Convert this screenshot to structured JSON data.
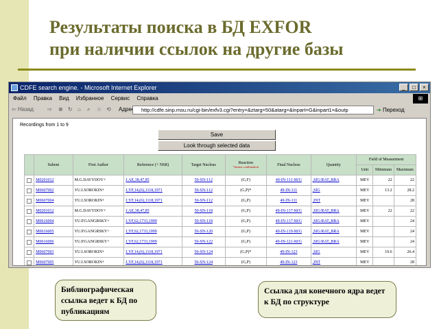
{
  "slide": {
    "title_line1": "Результаты поиска в БД EXFOR",
    "title_line2": "при наличии ссылок на другие базы"
  },
  "window": {
    "title": "CDFE search engine. - Microsoft Internet Explorer",
    "menu": [
      "Файл",
      "Правка",
      "Вид",
      "Избранное",
      "Сервис",
      "Справка"
    ],
    "toolbar": [
      "Назад",
      "◀",
      "▶",
      "⊗",
      "⌂",
      "Поиск",
      "Избранное",
      "Журнал"
    ],
    "address_label": "Адрес",
    "address": "http://cdfe.sinp.msu.ru/cgi-bin/exfv3.cgi?entry=&ztarg=50&atarg=&inpart=G&inpart1=&outp",
    "go_label": "Переход"
  },
  "page": {
    "records_text": "Recordings from 1 to 9",
    "save_label": "Save",
    "look_label": "Look through selected data"
  },
  "table": {
    "headers": [
      "Subent",
      "First Author",
      "Reference (+ NSR)",
      "Target Nucleus",
      "Reaction",
      "Final Nucleus",
      "Quantity",
      "Field of Measurment"
    ],
    "reaction_note": "*means combination",
    "field_subheaders": [
      "Unit",
      "Minimum",
      "Maximum"
    ],
    "rows": [
      {
        "subent": "M0201012",
        "author": "M.G.DAVYDOV+",
        "ref": "J.AE,38,47,85",
        "target": "50-SN-112",
        "reaction": "(G,F)",
        "final": "49-IN-111-M/G",
        "quantity": ",SIG/RAT,,BRA",
        "unit": "MEV",
        "min": "22",
        "max": "22"
      },
      {
        "subent": "M0607002",
        "author": "YU.I.SOROKIN+",
        "ref": "J,YF,14,(6),1118,1971",
        "target": "50-SN-112",
        "reaction": "(G,P)*",
        "final": "49-IN-111",
        "quantity": ",SIG",
        "unit": "MEV",
        "min": "13.2",
        "max": "28.2"
      },
      {
        "subent": "M0607004",
        "author": "YU.I.SOROKIN+",
        "ref": "J,YF,14,(6),1118,1971",
        "target": "50-SN-112",
        "reaction": "(G,P)",
        "final": "49-IN-111",
        "quantity": ",INT",
        "unit": "MEV",
        "min": "",
        "max": "28"
      },
      {
        "subent": "M0201012",
        "author": "M.G.DAVYDOV+",
        "ref": "J.AE,38,47,85",
        "target": "50-SN-118",
        "reaction": "(G,P)",
        "final": "49-IN-117-M/G",
        "quantity": ",SIG/RAT,,BRA",
        "unit": "MEV",
        "min": "22",
        "max": "22"
      },
      {
        "subent": "M0616004",
        "author": "YU.P.GANGRSKY+",
        "ref": "J,YF,62,1733,1999",
        "target": "50-SN-118",
        "reaction": "(G,P)",
        "final": "49-IN-117-M/G",
        "quantity": ",SIG/RAT,,BRA",
        "unit": "MEV",
        "min": "",
        "max": "24"
      },
      {
        "subent": "M0616005",
        "author": "YU.P.GANGRSKY+",
        "ref": "J,YF,62,1733,1999",
        "target": "50-SN-120",
        "reaction": "(G,P)",
        "final": "49-IN-119-M/G",
        "quantity": ",SIG/RAT,,BRA",
        "unit": "MEV",
        "min": "",
        "max": "24"
      },
      {
        "subent": "M0616006",
        "author": "YU.P.GANGRSKY+",
        "ref": "J,YF,62,1733,1999",
        "target": "50-SN-122",
        "reaction": "(G,P)",
        "final": "49-IN-121-M/G",
        "quantity": ",SIG/RAT,,BRA",
        "unit": "MEV",
        "min": "",
        "max": "24"
      },
      {
        "subent": "M0607003",
        "author": "YU.I.SOROKIN+",
        "ref": "J,YF,14,(6),1118,1971",
        "target": "50-SN-124",
        "reaction": "(G,P)*",
        "final": "49-IN-123",
        "quantity": ",SIG",
        "unit": "MEV",
        "min": "19.6",
        "max": "26.4"
      },
      {
        "subent": "M0607005",
        "author": "YU.I.SOROKIN+",
        "ref": "J,YF,14,(6),1118,1971",
        "target": "50-SN-124",
        "reaction": "(G,P)",
        "final": "49-IN-123",
        "quantity": ",INT",
        "unit": "MEV",
        "min": "",
        "max": "28"
      }
    ]
  },
  "callouts": {
    "left": "Библиографическая ссылка ведет к БД по публикациям",
    "right": "Ссылка для конечного ядра ведет к БД по структуре"
  }
}
